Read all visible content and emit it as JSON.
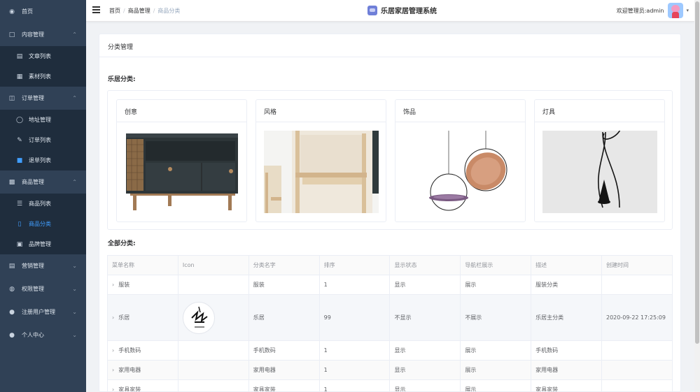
{
  "sidebar": {
    "home": {
      "label": "首页",
      "icon": "dashboard-icon"
    },
    "groups": [
      {
        "label": "内容管理",
        "icon": "folder-icon",
        "expanded": true,
        "items": [
          {
            "label": "文章列表",
            "icon": "document-icon"
          },
          {
            "label": "素材列表",
            "icon": "image-list-icon"
          }
        ]
      },
      {
        "label": "订单管理",
        "icon": "inbox-icon",
        "expanded": true,
        "items": [
          {
            "label": "地址管理",
            "icon": "user-icon"
          },
          {
            "label": "订单列表",
            "icon": "edit-document-icon"
          },
          {
            "label": "退单列表",
            "icon": "return-icon"
          }
        ]
      },
      {
        "label": "商品管理",
        "icon": "goods-icon",
        "expanded": true,
        "items": [
          {
            "label": "商品列表",
            "icon": "list-icon"
          },
          {
            "label": "商品分类",
            "icon": "bookmark-icon",
            "active": true
          },
          {
            "label": "品牌管理",
            "icon": "gift-icon"
          }
        ]
      },
      {
        "label": "营销管理",
        "icon": "coins-icon",
        "expanded": false
      },
      {
        "label": "权限管理",
        "icon": "toggle-icon",
        "expanded": false
      },
      {
        "label": "注册用户管理",
        "icon": "person-icon",
        "expanded": false
      },
      {
        "label": "个人中心",
        "icon": "person-icon",
        "expanded": false
      }
    ]
  },
  "header": {
    "breadcrumb": [
      "首页",
      "商品管理",
      "商品分类"
    ],
    "brand": "乐居家居管理系统",
    "welcome": "欢迎管理员:admin"
  },
  "main": {
    "card_title": "分类管理",
    "lejv_title": "乐居分类:",
    "categories": [
      {
        "name": "创意"
      },
      {
        "name": "风格"
      },
      {
        "name": "饰品"
      },
      {
        "name": "灯具"
      }
    ],
    "all_title": "全部分类:",
    "table": {
      "headers": [
        "菜单名称",
        "Icon",
        "分类名字",
        "排序",
        "显示状态",
        "导航栏展示",
        "描述",
        "创建时间"
      ],
      "rows": [
        {
          "name": "服装",
          "cname": "服装",
          "order": "1",
          "show": "显示",
          "nav": "展示",
          "desc": "服装分类",
          "created": "",
          "has_icon": false
        },
        {
          "name": "乐居",
          "cname": "乐居",
          "order": "99",
          "show": "不显示",
          "nav": "不展示",
          "desc": "乐居主分类",
          "created": "2020-09-22 17:25:09",
          "has_icon": true
        },
        {
          "name": "手机数码",
          "cname": "手机数码",
          "order": "1",
          "show": "显示",
          "nav": "展示",
          "desc": "手机数码",
          "created": "",
          "has_icon": false
        },
        {
          "name": "家用电器",
          "cname": "家用电器",
          "order": "1",
          "show": "显示",
          "nav": "展示",
          "desc": "家用电器",
          "created": "",
          "has_icon": false
        },
        {
          "name": "家具家装",
          "cname": "家具家装",
          "order": "1",
          "show": "显示",
          "nav": "展示",
          "desc": "家具家装",
          "created": "",
          "has_icon": false
        }
      ]
    }
  },
  "colors": {
    "sidebar_bg": "#304156",
    "submenu_bg": "#1f2d3d",
    "active": "#409eff"
  }
}
